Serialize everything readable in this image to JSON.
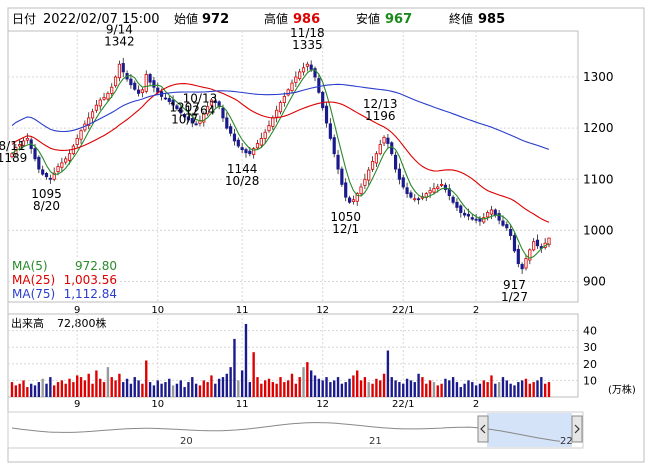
{
  "header": {
    "date_label": "日付",
    "date_value": "2022/02/07 15:00",
    "open_label": "始値",
    "open_value": "972",
    "high_label": "高値",
    "high_value": "986",
    "low_label": "安値",
    "low_value": "967",
    "close_label": "終値",
    "close_value": "985"
  },
  "colors": {
    "up": "#dd0000",
    "down": "#1a1a8c",
    "ma5": "#2a8a2a",
    "ma25": "#dd0000",
    "ma75": "#2a3ecc",
    "neutral_volume": "#999999"
  },
  "legend": [
    {
      "label": "MA(5)",
      "value": "972.80",
      "color_key": "ma5"
    },
    {
      "label": "MA(25)",
      "value": "1,003.56",
      "color_key": "ma25"
    },
    {
      "label": "MA(75)",
      "value": "1,112.84",
      "color_key": "ma75"
    }
  ],
  "volume_panel": {
    "title": "出来高",
    "value": "72,800株",
    "unit": "(万株)",
    "ticks": [
      "40",
      "30",
      "20",
      "10"
    ]
  },
  "price_ticks": [
    "1300",
    "1200",
    "1100",
    "1000",
    "900"
  ],
  "month_labels": [
    "9",
    "10",
    "11",
    "12",
    "22/1",
    "2"
  ],
  "navigator": {
    "labels": [
      "20",
      "21",
      "22"
    ],
    "left_handle_icon": "chevron-left-icon",
    "right_handle_icon": "chevron-right-icon"
  },
  "annotations": [
    {
      "text": "8/11",
      "sub": "1189"
    },
    {
      "text": "1095",
      "sub": "8/20"
    },
    {
      "text": "9/14",
      "sub": "1342"
    },
    {
      "text": "10/13",
      "sub": "1264"
    },
    {
      "text": "1207",
      "sub": "10/7"
    },
    {
      "text": "1144",
      "sub": "10/28"
    },
    {
      "text": "11/18",
      "sub": "1335"
    },
    {
      "text": "1050",
      "sub": "12/1"
    },
    {
      "text": "12/13",
      "sub": "1196"
    },
    {
      "text": "917",
      "sub": "1/27"
    }
  ],
  "chart_data": {
    "type": "candlestick",
    "period": "daily",
    "ylim": [
      860,
      1390
    ],
    "volume_ylim": [
      0,
      50
    ],
    "key_points": [
      {
        "date": "8/11",
        "price": 1189,
        "kind": "high"
      },
      {
        "date": "8/20",
        "price": 1095,
        "kind": "low"
      },
      {
        "date": "9/14",
        "price": 1342,
        "kind": "high"
      },
      {
        "date": "10/7",
        "price": 1207,
        "kind": "low"
      },
      {
        "date": "10/13",
        "price": 1264,
        "kind": "high"
      },
      {
        "date": "10/28",
        "price": 1144,
        "kind": "low"
      },
      {
        "date": "11/18",
        "price": 1335,
        "kind": "high"
      },
      {
        "date": "12/1",
        "price": 1050,
        "kind": "low"
      },
      {
        "date": "12/13",
        "price": 1196,
        "kind": "high"
      },
      {
        "date": "1/27",
        "price": 917,
        "kind": "low"
      }
    ],
    "last_bar": {
      "date": "2022/02/07",
      "open": 972,
      "high": 986,
      "low": 967,
      "close": 985
    },
    "moving_averages": [
      {
        "name": "MA(5)",
        "last": 972.8
      },
      {
        "name": "MA(25)",
        "last": 1003.56
      },
      {
        "name": "MA(75)",
        "last": 1112.84
      }
    ],
    "closes": [
      1150,
      1162,
      1168,
      1175,
      1180,
      1160,
      1140,
      1120,
      1110,
      1105,
      1100,
      1112,
      1125,
      1132,
      1140,
      1150,
      1165,
      1180,
      1195,
      1208,
      1220,
      1232,
      1245,
      1255,
      1260,
      1268,
      1280,
      1300,
      1325,
      1310,
      1296,
      1285,
      1276,
      1268,
      1275,
      1305,
      1290,
      1280,
      1270,
      1262,
      1258,
      1252,
      1245,
      1238,
      1230,
      1222,
      1216,
      1210,
      1208,
      1215,
      1228,
      1242,
      1255,
      1250,
      1242,
      1220,
      1200,
      1190,
      1175,
      1165,
      1158,
      1152,
      1150,
      1160,
      1170,
      1180,
      1192,
      1205,
      1220,
      1235,
      1250,
      1262,
      1275,
      1288,
      1300,
      1310,
      1318,
      1325,
      1315,
      1300,
      1270,
      1240,
      1210,
      1180,
      1150,
      1120,
      1090,
      1065,
      1055,
      1060,
      1072,
      1085,
      1100,
      1118,
      1135,
      1150,
      1168,
      1182,
      1170,
      1150,
      1120,
      1100,
      1085,
      1072,
      1065,
      1062,
      1060,
      1066,
      1072,
      1078,
      1082,
      1085,
      1090,
      1080,
      1068,
      1055,
      1045,
      1035,
      1030,
      1028,
      1022,
      1020,
      1018,
      1025,
      1035,
      1040,
      1030,
      1020,
      1010,
      1005,
      990,
      960,
      935,
      925,
      945,
      962,
      978,
      970,
      965,
      975,
      985
    ],
    "volumes": [
      9,
      7,
      8,
      10,
      6,
      8,
      7,
      9,
      11,
      8,
      12,
      7,
      9,
      10,
      8,
      11,
      9,
      13,
      12,
      10,
      14,
      8,
      16,
      11,
      9,
      18,
      12,
      10,
      14,
      9,
      11,
      8,
      12,
      10,
      8,
      22,
      9,
      7,
      10,
      8,
      9,
      11,
      7,
      8,
      10,
      6,
      9,
      12,
      8,
      7,
      10,
      9,
      13,
      8,
      11,
      12,
      14,
      18,
      35,
      10,
      16,
      44,
      9,
      27,
      12,
      8,
      10,
      11,
      9,
      8,
      12,
      9,
      10,
      14,
      8,
      12,
      18,
      21,
      16,
      13,
      11,
      10,
      12,
      9,
      10,
      12,
      8,
      9,
      11,
      13,
      16,
      10,
      12,
      9,
      8,
      11,
      10,
      14,
      28,
      12,
      10,
      9,
      8,
      11,
      10,
      9,
      14,
      12,
      8,
      10,
      9,
      7,
      8,
      11,
      10,
      12,
      9,
      6,
      8,
      10,
      9,
      7,
      8,
      10,
      9,
      13,
      8,
      9,
      12,
      10,
      8,
      7,
      9,
      10,
      11,
      8,
      9,
      10,
      12,
      8,
      9
    ]
  }
}
